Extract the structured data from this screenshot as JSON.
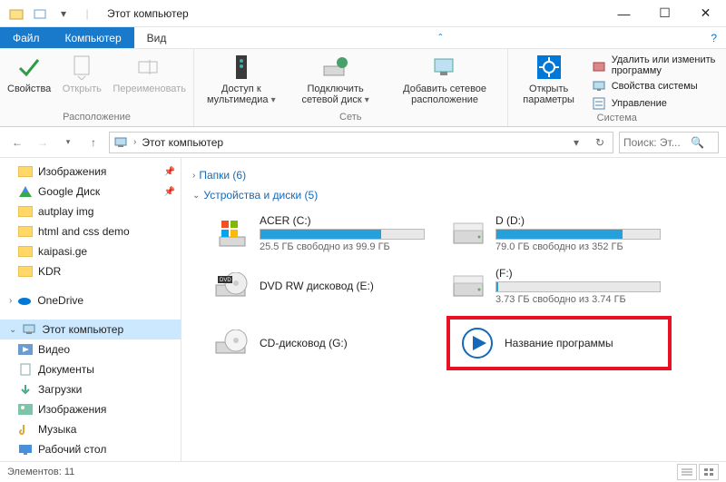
{
  "window": {
    "title": "Этот компьютер"
  },
  "tabs": {
    "file": "Файл",
    "computer": "Компьютер",
    "view": "Вид"
  },
  "ribbon": {
    "group1_label": "Расположение",
    "props": "Свойства",
    "open": "Открыть",
    "rename": "Переименовать",
    "group2_label": "Сеть",
    "media": "Доступ к\nмультимедиа",
    "netdrive": "Подключить\nсетевой диск",
    "addnet": "Добавить сетевое\nрасположение",
    "group3_label": "Система",
    "openparams": "Открыть\nпараметры",
    "uninstall": "Удалить или изменить программу",
    "sysprops": "Свойства системы",
    "manage": "Управление"
  },
  "nav": {
    "crumb": "Этот компьютер",
    "search_placeholder": "Поиск: Эт..."
  },
  "sidebar": {
    "items": [
      {
        "label": "Изображения",
        "type": "folder",
        "pinned": true
      },
      {
        "label": "Google Диск",
        "type": "gdrive",
        "pinned": true
      },
      {
        "label": "autplay img",
        "type": "folder"
      },
      {
        "label": "html and css demo",
        "type": "folder"
      },
      {
        "label": "kaipasi.ge",
        "type": "folder"
      },
      {
        "label": "KDR",
        "type": "folder"
      }
    ],
    "onedrive": "OneDrive",
    "thispc": "Этот компьютер",
    "libs": [
      {
        "label": "Видео"
      },
      {
        "label": "Документы"
      },
      {
        "label": "Загрузки"
      },
      {
        "label": "Изображения"
      },
      {
        "label": "Музыка"
      },
      {
        "label": "Рабочий стол"
      }
    ]
  },
  "content": {
    "folders_header": "Папки (6)",
    "devices_header": "Устройства и диски (5)",
    "drives": [
      {
        "name": "ACER (C:)",
        "free": "25.5 ГБ свободно из 99.9 ГБ",
        "fill": 74,
        "icon": "win"
      },
      {
        "name": "D (D:)",
        "free": "79.0 ГБ свободно из 352 ГБ",
        "fill": 77,
        "icon": "hdd"
      },
      {
        "name": "DVD RW дисковод (E:)",
        "free": "",
        "fill": null,
        "icon": "dvd"
      },
      {
        "name": "(F:)",
        "free": "3.73 ГБ свободно из 3.74 ГБ",
        "fill": 1,
        "icon": "hdd"
      },
      {
        "name": "CD-дисковод (G:)",
        "free": "",
        "fill": null,
        "icon": "cd"
      },
      {
        "name": "Название программы",
        "free": "",
        "fill": null,
        "icon": "play",
        "highlight": true
      }
    ]
  },
  "status": {
    "elements": "Элементов: 11"
  }
}
